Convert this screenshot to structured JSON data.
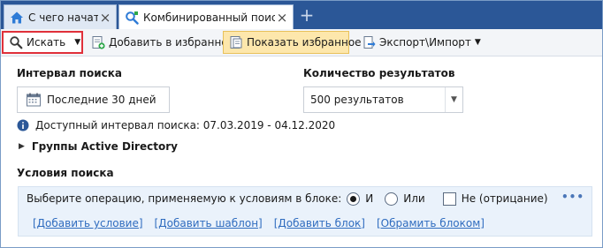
{
  "tabs": [
    {
      "label": "С чего начать",
      "icon": "home-icon",
      "active": false
    },
    {
      "label": "Комбинированный поиск",
      "icon": "search-tab-icon",
      "active": true
    }
  ],
  "toolbar": {
    "search_label": "Искать",
    "add_favorite_label": "Добавить в избранное",
    "show_favorites_label": "Показать избранное",
    "export_import_label": "Экспорт\\Импорт"
  },
  "interval": {
    "heading": "Интервал поиска",
    "value": "Последние 30 дней",
    "available_text": "Доступный интервал поиска: 07.03.2019 - 04.12.2020"
  },
  "results": {
    "heading": "Количество результатов",
    "value": "500 результатов"
  },
  "ad_groups": {
    "label": "Группы Active Directory"
  },
  "conditions": {
    "heading": "Условия поиска",
    "operation_prompt": "Выберите операцию, применяемую к условиям в блоке:",
    "option_and": "И",
    "option_or": "Или",
    "option_not": "Не (отрицание)",
    "more_label": "•••",
    "links": [
      "[Добавить условие]",
      "[Добавить шаблон]",
      "[Добавить блок]",
      "[Обрамить блоком]"
    ]
  },
  "colors": {
    "tabbar": "#2b5797",
    "highlight_button": "#fde7ac",
    "focus_outline": "#e0303a",
    "link": "#2f6cbf",
    "panel": "#eaf2fb"
  }
}
